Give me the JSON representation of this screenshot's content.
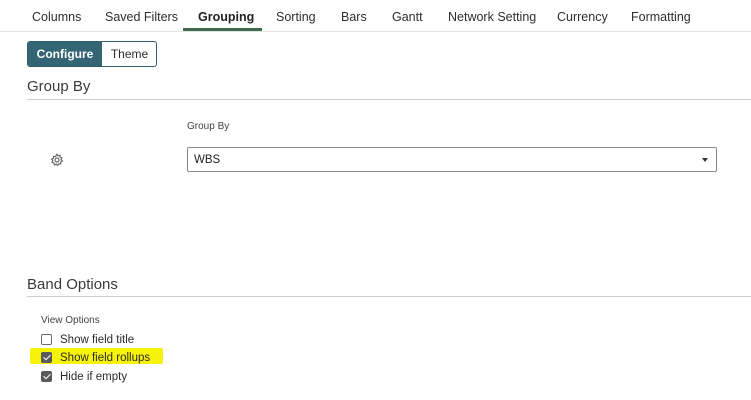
{
  "tabs": [
    {
      "label": "Columns"
    },
    {
      "label": "Saved Filters"
    },
    {
      "label": "Grouping",
      "active": true
    },
    {
      "label": "Sorting"
    },
    {
      "label": "Bars"
    },
    {
      "label": "Gantt"
    },
    {
      "label": "Network Setting"
    },
    {
      "label": "Currency"
    },
    {
      "label": "Formatting"
    }
  ],
  "segment": {
    "configure": "Configure",
    "theme": "Theme",
    "selected": "Configure"
  },
  "group_by": {
    "section_title": "Group By",
    "field_label": "Group By",
    "value": "WBS",
    "icon": "gear-icon"
  },
  "band_options": {
    "section_title": "Band Options",
    "view_options_label": "View Options",
    "options": [
      {
        "label": "Show field title",
        "checked": false
      },
      {
        "label": "Show field rollups",
        "checked": true,
        "highlighted": true
      },
      {
        "label": "Hide if empty",
        "checked": true
      }
    ]
  },
  "colors": {
    "accent": "#346575",
    "tab_underline": "#3e6a4e",
    "highlight": "#f6f20a"
  }
}
